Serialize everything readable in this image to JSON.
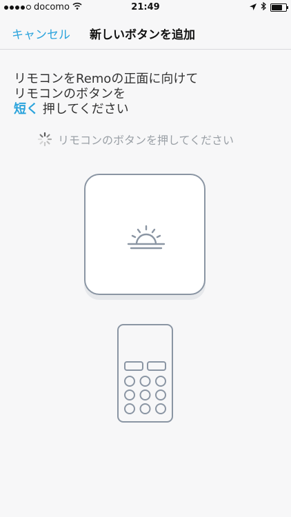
{
  "status_bar": {
    "carrier": "docomo",
    "time": "21:49",
    "signal_icon": "signal-dots-icon",
    "wifi_icon": "wifi-icon",
    "location_icon": "location-arrow-icon",
    "bluetooth_icon": "bluetooth-icon",
    "battery_icon": "battery-icon",
    "battery_level": 0.85
  },
  "nav": {
    "cancel_label": "キャンセル",
    "title": "新しいボタンを追加"
  },
  "instruction": {
    "line1": "リモコンをRemoの正面に向けて",
    "line2": "リモコンのボタンを",
    "emphasis": "短く",
    "line3_rest": "押してください"
  },
  "waiting": {
    "text": "リモコンのボタンを押してください",
    "icon": "spinner-icon"
  },
  "illustration": {
    "remo_icon": "sunrise-icon",
    "remote_icon": "remote-control-icon"
  },
  "colors": {
    "accent": "#2aa3dc",
    "device_outline": "#8a95a3",
    "muted_text": "#9aa0a6"
  }
}
